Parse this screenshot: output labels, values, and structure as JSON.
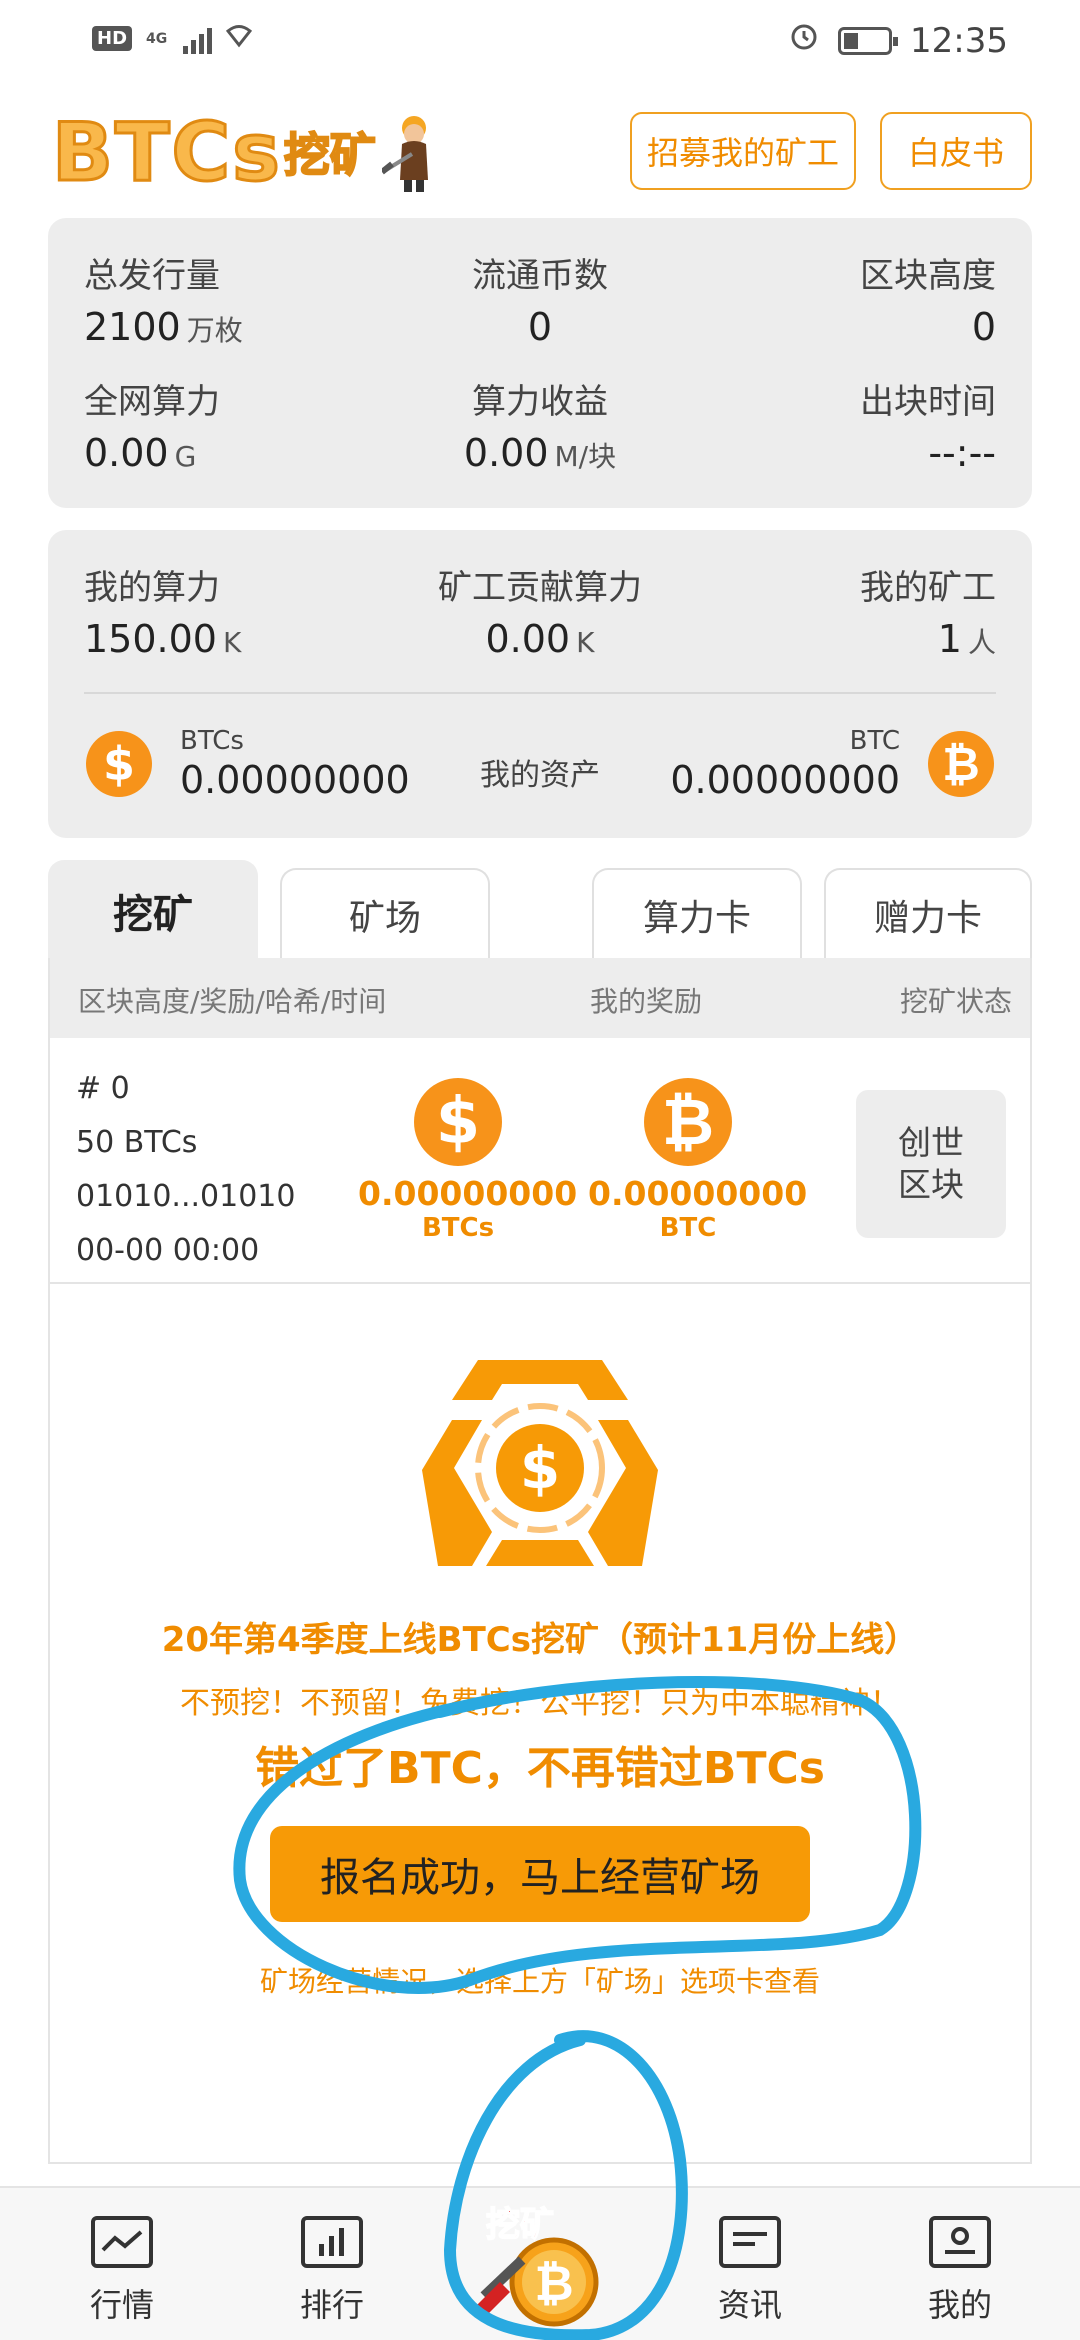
{
  "status_bar": {
    "network": "4G",
    "hd": "HD",
    "time": "12:35"
  },
  "header": {
    "logo_text": "BTCs",
    "logo_sub": "挖矿",
    "recruit_button": "招募我的矿工",
    "whitepaper_button": "白皮书"
  },
  "network_stats": {
    "total_supply": {
      "label": "总发行量",
      "value": "2100",
      "unit": "万枚"
    },
    "circulating": {
      "label": "流通币数",
      "value": "0"
    },
    "block_height": {
      "label": "区块高度",
      "value": "0"
    },
    "network_hashrate": {
      "label": "全网算力",
      "value": "0.00",
      "unit": "G"
    },
    "hashrate_yield": {
      "label": "算力收益",
      "value": "0.00",
      "unit": "M/块"
    },
    "block_time": {
      "label": "出块时间",
      "value": "--:--"
    }
  },
  "my_stats": {
    "my_hashrate": {
      "label": "我的算力",
      "value": "150.00",
      "unit": "K"
    },
    "miner_contribution": {
      "label": "矿工贡献算力",
      "value": "0.00",
      "unit": "K"
    },
    "my_miners": {
      "label": "我的矿工",
      "value": "1",
      "unit": "人"
    },
    "assets_label": "我的资产",
    "btcs": {
      "label": "BTCs",
      "value": "0.00000000"
    },
    "btc": {
      "label": "BTC",
      "value": "0.00000000"
    }
  },
  "tabs": [
    {
      "label": "挖矿",
      "active": true
    },
    {
      "label": "矿场",
      "active": false
    },
    {
      "label": "算力卡",
      "active": false
    },
    {
      "label": "赠力卡",
      "active": false
    }
  ],
  "table": {
    "headers": {
      "block": "区块高度/奖励/哈希/时间",
      "reward": "我的奖励",
      "status": "挖矿状态"
    },
    "rows": [
      {
        "height": "# 0",
        "block_reward": "50 BTCs",
        "hash": "01010...01010",
        "time": "00-00 00:00",
        "reward_btcs": "0.00000000",
        "reward_btcs_unit": "BTCs",
        "reward_btc": "0.00000000",
        "reward_btc_unit": "BTC",
        "status": "创世区块"
      }
    ]
  },
  "promo": {
    "line1": "20年第4季度上线BTCs挖矿（预计11月份上线）",
    "line2": "不预挖！不预留！免费挖！公平挖！只为中本聪精神！",
    "line3": "错过了BTC，不再错过BTCs",
    "signup_button": "报名成功，马上经营矿场",
    "note": "矿场经营情况，选择上方「矿场」选项卡查看"
  },
  "bottom_nav": [
    {
      "label": "行情",
      "icon": "chart-line-icon"
    },
    {
      "label": "排行",
      "icon": "bar-chart-icon"
    },
    {
      "label": "挖矿",
      "icon": "mining-icon"
    },
    {
      "label": "资讯",
      "icon": "news-icon"
    },
    {
      "label": "我的",
      "icon": "profile-icon"
    }
  ],
  "colors": {
    "accent": "#f79a06",
    "coin": "#f7931a",
    "card_bg": "#ededed",
    "annotation": "#29a9e0"
  }
}
